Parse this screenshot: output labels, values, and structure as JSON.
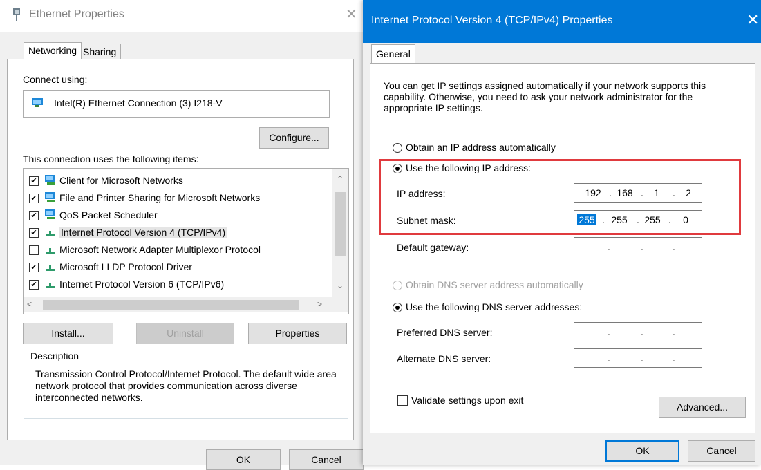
{
  "colors": {
    "accent": "#0078d7",
    "highlight_box": "#e03a3e"
  },
  "ethernet": {
    "title": "Ethernet Properties",
    "close_glyph": "✕",
    "tabs": [
      {
        "label": "Networking"
      },
      {
        "label": "Sharing"
      }
    ],
    "connect_using_label": "Connect using:",
    "adapter_name": "Intel(R) Ethernet Connection (3) I218-V",
    "configure_button": "Configure...",
    "items_label": "This connection uses the following items:",
    "items": [
      {
        "label": "Client for Microsoft Networks",
        "checked": true,
        "icon": "network-computer-icon"
      },
      {
        "label": "File and Printer Sharing for Microsoft Networks",
        "checked": true,
        "icon": "network-computer-icon"
      },
      {
        "label": "QoS Packet Scheduler",
        "checked": true,
        "icon": "network-computer-icon"
      },
      {
        "label": "Internet Protocol Version 4 (TCP/IPv4)",
        "checked": true,
        "icon": "protocol-icon",
        "selected": true
      },
      {
        "label": "Microsoft Network Adapter Multiplexor Protocol",
        "checked": false,
        "icon": "protocol-icon"
      },
      {
        "label": "Microsoft LLDP Protocol Driver",
        "checked": true,
        "icon": "protocol-icon"
      },
      {
        "label": "Internet Protocol Version 6 (TCP/IPv6)",
        "checked": true,
        "icon": "protocol-icon"
      }
    ],
    "install_button": "Install...",
    "uninstall_button": "Uninstall",
    "properties_button": "Properties",
    "description_legend": "Description",
    "description_text": "Transmission Control Protocol/Internet Protocol. The default wide area network protocol that provides communication across diverse interconnected networks.",
    "ok_button": "OK",
    "cancel_button": "Cancel"
  },
  "ipv4": {
    "title": "Internet Protocol Version 4 (TCP/IPv4) Properties",
    "close_glyph": "✕",
    "tab": "General",
    "intro": "You can get IP settings assigned automatically if your network supports this capability. Otherwise, you need to ask your network administrator for the appropriate IP settings.",
    "obtain_ip_auto": "Obtain an IP address automatically",
    "use_following_ip": "Use the following IP address:",
    "ip_address_label": "IP address:",
    "ip_address": [
      "192",
      "168",
      "1",
      "2"
    ],
    "subnet_label": "Subnet mask:",
    "subnet": [
      "255",
      "255",
      "255",
      "0"
    ],
    "gateway_label": "Default gateway:",
    "gateway": [
      "",
      "",
      "",
      ""
    ],
    "obtain_dns_auto": "Obtain DNS server address automatically",
    "use_following_dns": "Use the following DNS server addresses:",
    "preferred_dns_label": "Preferred DNS server:",
    "preferred_dns": [
      "",
      "",
      "",
      ""
    ],
    "alternate_dns_label": "Alternate DNS server:",
    "alternate_dns": [
      "",
      "",
      "",
      ""
    ],
    "validate_label": "Validate settings upon exit",
    "advanced_button": "Advanced...",
    "ok_button": "OK",
    "cancel_button": "Cancel"
  }
}
